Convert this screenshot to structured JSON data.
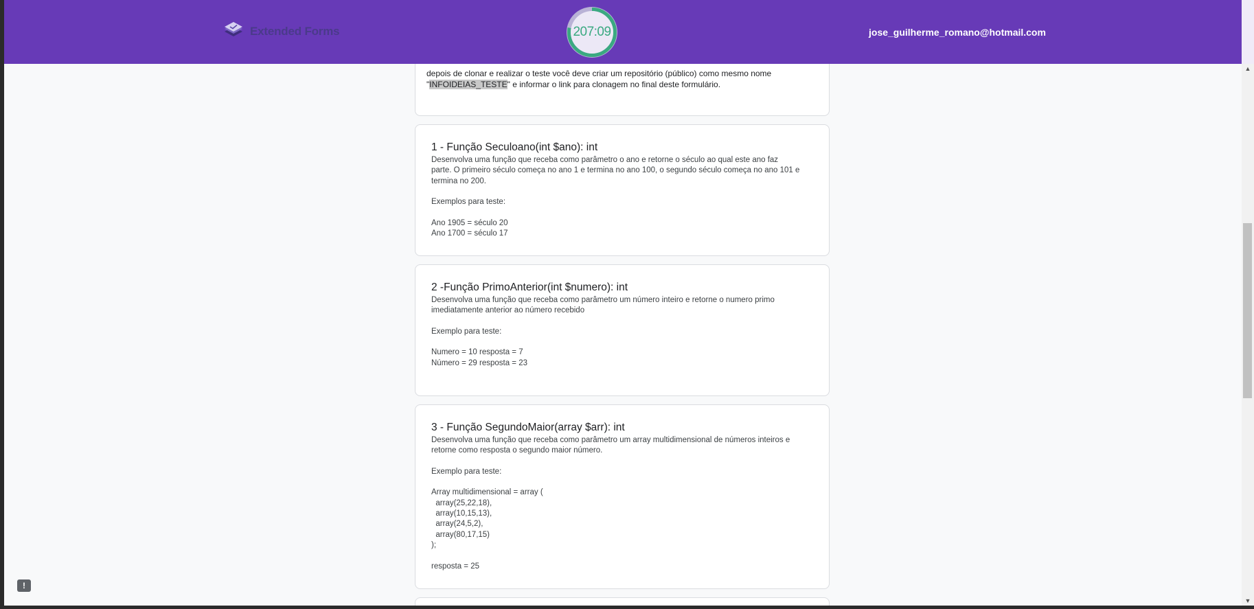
{
  "header": {
    "brand_name": "Extended Forms",
    "timer": "207:09",
    "timer_progress": 0.78,
    "user_email": "jose_guilherme_romano@hotmail.com",
    "colors": {
      "bar": "#673ab7",
      "timer_ring": "#3aa981",
      "timer_track": "#b9b2d6"
    }
  },
  "intro": {
    "text_before": "depois de clonar e realizar o teste você deve criar um repositório (público) como mesmo nome \"",
    "highlight": "INFOIDEIAS_TESTE",
    "text_after": "\" e informar o link para clonagem no final deste formulário."
  },
  "questions": [
    {
      "title": "1 - Função Seculoano(int $ano): int",
      "lines": [
        "Desenvolva uma função que receba como parâmetro o ano e retorne o século ao qual este ano faz",
        "parte. O primeiro século começa no ano 1 e termina no ano 100, o segundo século começa no ano 101 e",
        "termina no 200.",
        "",
        "Exemplos para teste:",
        "",
        "Ano 1905 = século 20",
        "Ano 1700 = século 17"
      ]
    },
    {
      "title": "2 -Função PrimoAnterior(int $numero): int",
      "lines": [
        "Desenvolva uma função que receba como parâmetro um número inteiro e retorne o numero primo",
        "imediatamente anterior ao número recebido",
        "",
        "Exemplo para teste:",
        "",
        "Numero = 10 resposta = 7",
        "Número = 29 resposta = 23"
      ]
    },
    {
      "title": "3 - Função SegundoMaior(array $arr): int",
      "lines": [
        "Desenvolva uma função que receba como parâmetro um array multidimensional de números inteiros e",
        "retorne como resposta o segundo maior número.",
        "",
        "Exemplo para teste:",
        "",
        "Array multidimensional = array (",
        "  array(25,22,18),",
        "  array(10,15,13),",
        "  array(24,5,2),",
        "  array(80,17,15)",
        ");",
        "",
        "resposta = 25"
      ]
    }
  ],
  "feedback": {
    "icon": "report-icon",
    "glyph": "!"
  }
}
